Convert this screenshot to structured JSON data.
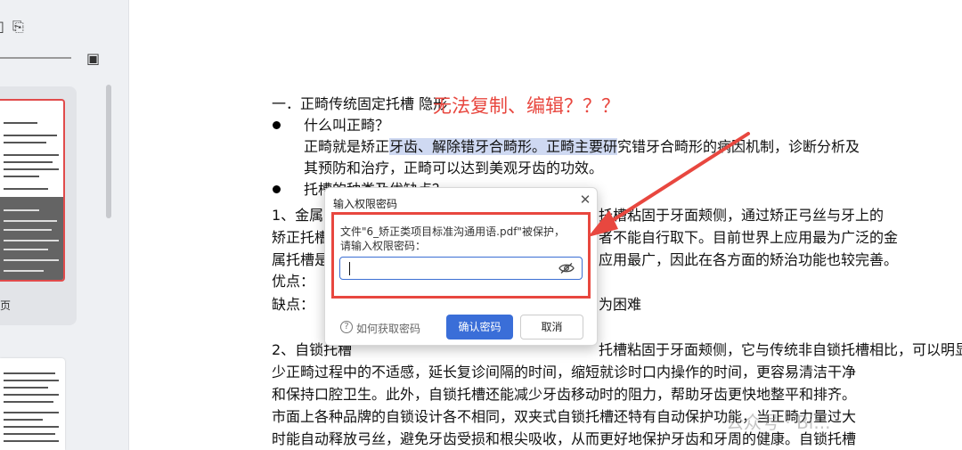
{
  "sidebar": {
    "tools": [
      "grid-icon",
      "extract-icon",
      "image-icon"
    ],
    "thumbnails": [
      {
        "label": "页",
        "selected": true
      },
      {
        "label": "",
        "selected": false
      }
    ]
  },
  "doc": {
    "lines": {
      "l1": "一．正畸传统固定托槽  隐形",
      "l2": "什么叫正畸？",
      "l3_a": "正畸就是矫正",
      "l3_hl": "牙齿、解除错牙合畸形。正畸主要研",
      "l3_b": "究错牙合畸形的病因机制，诊断分析及",
      "l4": "其预防和治疗，正畸可以达到美观牙齿的功效。",
      "l5": "托槽的种类及优缺点？",
      "l6a": "1、金属",
      "l6b": "托槽粘固于牙面颊侧，通过矫正弓丝与牙上的",
      "l7a": "矫正托槽",
      "l7b": "者不能自行取下。目前世界上应用最为广泛的金",
      "l8a": "属托槽是",
      "l8b": "应用最广，因此在各方面的矫治功能也较完善。",
      "l9": "优点：",
      "l10a": "缺点：",
      "l10b": "为困难",
      "l11": "2、自锁托槽，自锁托槽是目前最先进的颊侧固定托槽，它与传统非自锁托槽相比，可以明显减",
      "l11_vis": "托槽粘固于牙面颊侧，它与传统非自锁托槽相比，可以明显减",
      "l12": "少正畸过程中的不适感，延长复诊间隔的时间，缩短就诊时口内操作的时间，更容易清洁干净",
      "l13": "和保持口腔卫生。此外，自锁托槽还能减少牙齿移动时的阻力，帮助牙齿更快地整平和排齐。",
      "l14": "市面上各种品牌的自锁设计各不相同，双夹式自锁托槽还特有自动保护功能，当正畸力量过大",
      "l15": "时能自动释放弓丝，避免牙齿受损和根尖吸收，从而更好地保护牙齿和牙周的健康。自锁托槽"
    },
    "l11_prefix": "2、自锁托槽",
    "l11_rest": "托槽粘固于牙面颊侧，它与传统非自锁托槽相比，可以明显减"
  },
  "annotation": {
    "text": "无法复制、编辑？？？",
    "color": "#e8473f"
  },
  "dialog": {
    "title": "输入权限密码",
    "message_line1": "文件\"6_矫正类项目标准沟通用语.pdf\"被保护，",
    "message_line2": "请输入权限密码：",
    "password_value": "",
    "help_link": "如何获取密码",
    "confirm_label": "确认密码",
    "cancel_label": "取消",
    "accent": "#3a6ed8"
  },
  "watermark": "公众号 · Bi..."
}
